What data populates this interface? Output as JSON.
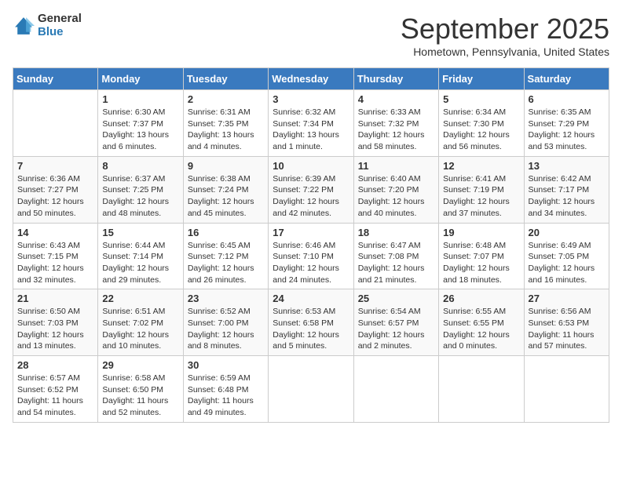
{
  "header": {
    "logo_general": "General",
    "logo_blue": "Blue",
    "month_title": "September 2025",
    "subtitle": "Hometown, Pennsylvania, United States"
  },
  "days_of_week": [
    "Sunday",
    "Monday",
    "Tuesday",
    "Wednesday",
    "Thursday",
    "Friday",
    "Saturday"
  ],
  "weeks": [
    [
      {
        "day": "",
        "info": ""
      },
      {
        "day": "1",
        "info": "Sunrise: 6:30 AM\nSunset: 7:37 PM\nDaylight: 13 hours\nand 6 minutes."
      },
      {
        "day": "2",
        "info": "Sunrise: 6:31 AM\nSunset: 7:35 PM\nDaylight: 13 hours\nand 4 minutes."
      },
      {
        "day": "3",
        "info": "Sunrise: 6:32 AM\nSunset: 7:34 PM\nDaylight: 13 hours\nand 1 minute."
      },
      {
        "day": "4",
        "info": "Sunrise: 6:33 AM\nSunset: 7:32 PM\nDaylight: 12 hours\nand 58 minutes."
      },
      {
        "day": "5",
        "info": "Sunrise: 6:34 AM\nSunset: 7:30 PM\nDaylight: 12 hours\nand 56 minutes."
      },
      {
        "day": "6",
        "info": "Sunrise: 6:35 AM\nSunset: 7:29 PM\nDaylight: 12 hours\nand 53 minutes."
      }
    ],
    [
      {
        "day": "7",
        "info": "Sunrise: 6:36 AM\nSunset: 7:27 PM\nDaylight: 12 hours\nand 50 minutes."
      },
      {
        "day": "8",
        "info": "Sunrise: 6:37 AM\nSunset: 7:25 PM\nDaylight: 12 hours\nand 48 minutes."
      },
      {
        "day": "9",
        "info": "Sunrise: 6:38 AM\nSunset: 7:24 PM\nDaylight: 12 hours\nand 45 minutes."
      },
      {
        "day": "10",
        "info": "Sunrise: 6:39 AM\nSunset: 7:22 PM\nDaylight: 12 hours\nand 42 minutes."
      },
      {
        "day": "11",
        "info": "Sunrise: 6:40 AM\nSunset: 7:20 PM\nDaylight: 12 hours\nand 40 minutes."
      },
      {
        "day": "12",
        "info": "Sunrise: 6:41 AM\nSunset: 7:19 PM\nDaylight: 12 hours\nand 37 minutes."
      },
      {
        "day": "13",
        "info": "Sunrise: 6:42 AM\nSunset: 7:17 PM\nDaylight: 12 hours\nand 34 minutes."
      }
    ],
    [
      {
        "day": "14",
        "info": "Sunrise: 6:43 AM\nSunset: 7:15 PM\nDaylight: 12 hours\nand 32 minutes."
      },
      {
        "day": "15",
        "info": "Sunrise: 6:44 AM\nSunset: 7:14 PM\nDaylight: 12 hours\nand 29 minutes."
      },
      {
        "day": "16",
        "info": "Sunrise: 6:45 AM\nSunset: 7:12 PM\nDaylight: 12 hours\nand 26 minutes."
      },
      {
        "day": "17",
        "info": "Sunrise: 6:46 AM\nSunset: 7:10 PM\nDaylight: 12 hours\nand 24 minutes."
      },
      {
        "day": "18",
        "info": "Sunrise: 6:47 AM\nSunset: 7:08 PM\nDaylight: 12 hours\nand 21 minutes."
      },
      {
        "day": "19",
        "info": "Sunrise: 6:48 AM\nSunset: 7:07 PM\nDaylight: 12 hours\nand 18 minutes."
      },
      {
        "day": "20",
        "info": "Sunrise: 6:49 AM\nSunset: 7:05 PM\nDaylight: 12 hours\nand 16 minutes."
      }
    ],
    [
      {
        "day": "21",
        "info": "Sunrise: 6:50 AM\nSunset: 7:03 PM\nDaylight: 12 hours\nand 13 minutes."
      },
      {
        "day": "22",
        "info": "Sunrise: 6:51 AM\nSunset: 7:02 PM\nDaylight: 12 hours\nand 10 minutes."
      },
      {
        "day": "23",
        "info": "Sunrise: 6:52 AM\nSunset: 7:00 PM\nDaylight: 12 hours\nand 8 minutes."
      },
      {
        "day": "24",
        "info": "Sunrise: 6:53 AM\nSunset: 6:58 PM\nDaylight: 12 hours\nand 5 minutes."
      },
      {
        "day": "25",
        "info": "Sunrise: 6:54 AM\nSunset: 6:57 PM\nDaylight: 12 hours\nand 2 minutes."
      },
      {
        "day": "26",
        "info": "Sunrise: 6:55 AM\nSunset: 6:55 PM\nDaylight: 12 hours\nand 0 minutes."
      },
      {
        "day": "27",
        "info": "Sunrise: 6:56 AM\nSunset: 6:53 PM\nDaylight: 11 hours\nand 57 minutes."
      }
    ],
    [
      {
        "day": "28",
        "info": "Sunrise: 6:57 AM\nSunset: 6:52 PM\nDaylight: 11 hours\nand 54 minutes."
      },
      {
        "day": "29",
        "info": "Sunrise: 6:58 AM\nSunset: 6:50 PM\nDaylight: 11 hours\nand 52 minutes."
      },
      {
        "day": "30",
        "info": "Sunrise: 6:59 AM\nSunset: 6:48 PM\nDaylight: 11 hours\nand 49 minutes."
      },
      {
        "day": "",
        "info": ""
      },
      {
        "day": "",
        "info": ""
      },
      {
        "day": "",
        "info": ""
      },
      {
        "day": "",
        "info": ""
      }
    ]
  ]
}
